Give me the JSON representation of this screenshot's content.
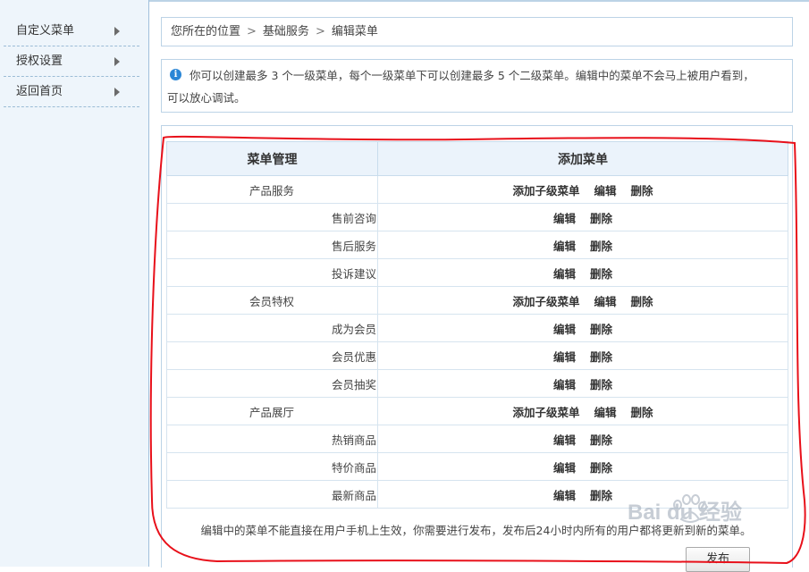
{
  "sidebar": {
    "items": [
      {
        "label": "自定义菜单"
      },
      {
        "label": "授权设置"
      },
      {
        "label": "返回首页"
      }
    ]
  },
  "breadcrumb": {
    "items": [
      "您所在的位置",
      "基础服务",
      "编辑菜单"
    ],
    "separator": ">"
  },
  "notice": {
    "line1": "你可以创建最多 3 个一级菜单，每个一级菜单下可以创建最多 5 个二级菜单。编辑中的菜单不会马上被用户看到，",
    "line2": "可以放心调试。"
  },
  "table": {
    "header_menu": "菜单管理",
    "header_add": "添加菜单",
    "add_sub_label": "添加子级菜单",
    "edit_label": "编辑",
    "delete_label": "删除",
    "groups": [
      {
        "name": "产品服务",
        "children": [
          "售前咨询",
          "售后服务",
          "投诉建议"
        ]
      },
      {
        "name": "会员特权",
        "children": [
          "成为会员",
          "会员优惠",
          "会员抽奖"
        ]
      },
      {
        "name": "产品展厅",
        "children": [
          "热销商品",
          "特价商品",
          "最新商品"
        ]
      }
    ]
  },
  "footnote": "编辑中的菜单不能直接在用户手机上生效，你需要进行发布，发布后24小时内所有的用户都将更新到新的菜单。",
  "publish_label": "发布",
  "watermark": {
    "text": "Bai du 经验"
  },
  "colors": {
    "sidebar_bg": "#eef5fb",
    "border": "#bcd3e6",
    "header_bg": "#ebf3fb",
    "annotation": "#e8101a",
    "info_icon": "#2a86d6"
  }
}
